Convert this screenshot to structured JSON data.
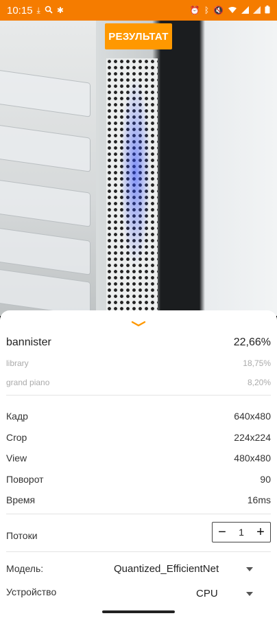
{
  "status_bar": {
    "time": "10:15",
    "left_icons": [
      "download-icon",
      "search-icon",
      "pinwheel-icon"
    ],
    "right_icons": [
      "alarm-icon",
      "bluetooth-icon",
      "mute-icon",
      "wifi-icon",
      "signal-icon",
      "signal-icon",
      "battery-icon"
    ],
    "color": "#f57c00"
  },
  "camera": {
    "result_button": "РЕЗУЛЬТАТ",
    "accent": "#ff9800"
  },
  "results": {
    "top": {
      "label": "bannister",
      "value": "22,66%"
    },
    "others": [
      {
        "label": "library",
        "value": "18,75%"
      },
      {
        "label": "grand piano",
        "value": "8,20%"
      }
    ]
  },
  "info": [
    {
      "label": "Кадр",
      "value": "640x480"
    },
    {
      "label": "Crop",
      "value": "224x224"
    },
    {
      "label": "View",
      "value": "480x480"
    },
    {
      "label": "Поворот",
      "value": "90"
    },
    {
      "label": "Время",
      "value": "16ms"
    }
  ],
  "threads": {
    "label": "Потоки",
    "value": "1",
    "minus": "−",
    "plus": "+"
  },
  "model": {
    "label": "Модель:",
    "value": "Quantized_EfficientNet"
  },
  "device": {
    "label": "Устройство",
    "value": "CPU"
  }
}
